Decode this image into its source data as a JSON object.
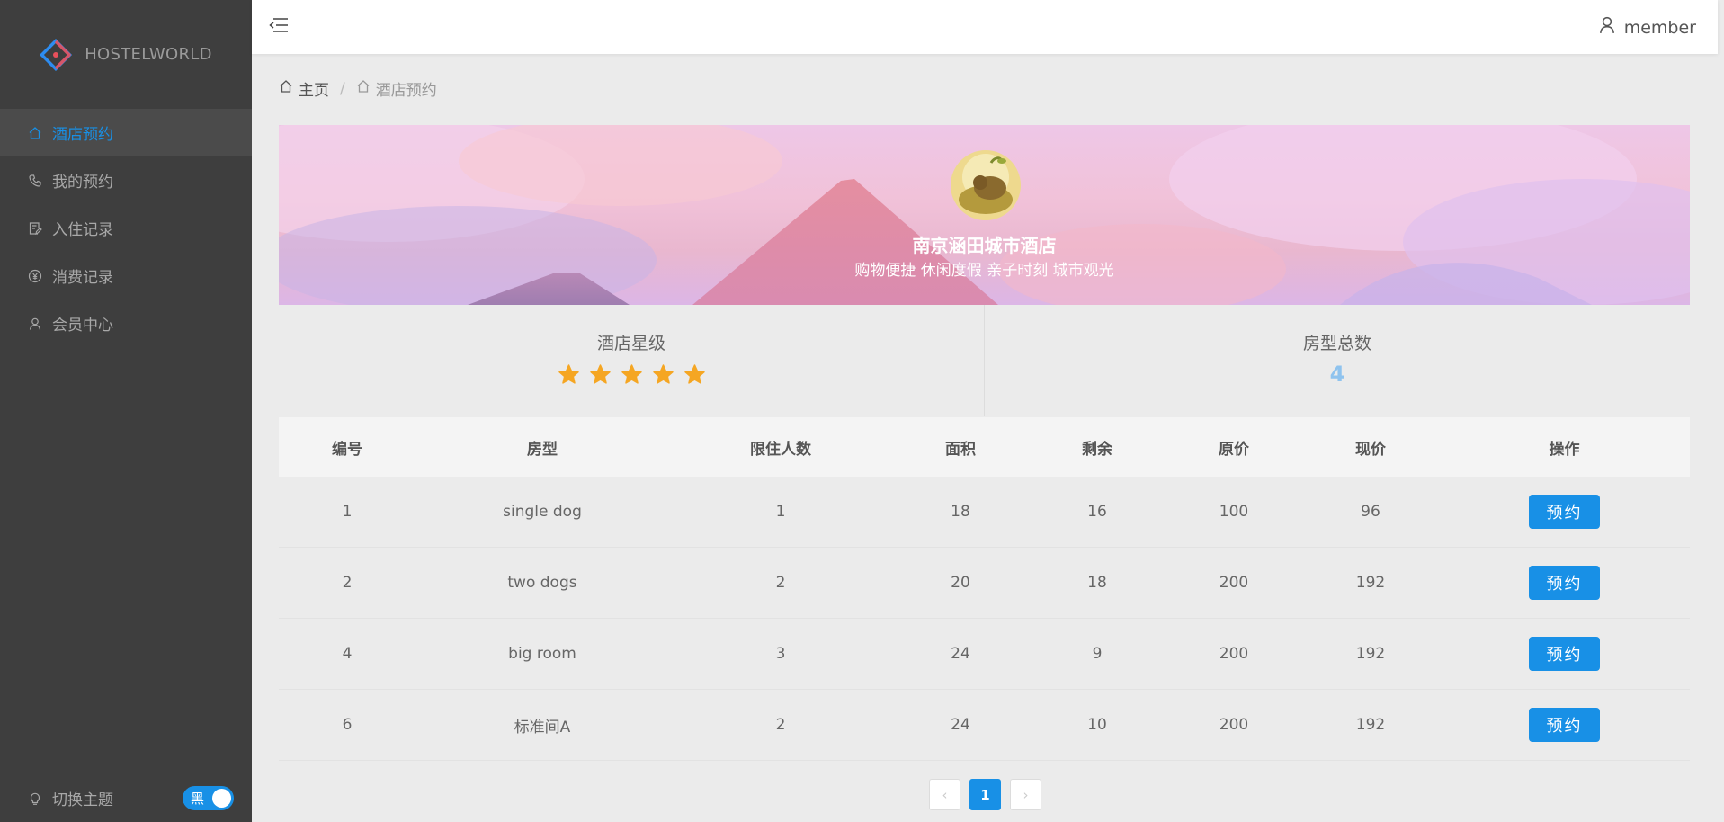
{
  "brand": {
    "name": "HOSTELWORLD"
  },
  "sidebar": {
    "items": [
      {
        "label": "酒店预约",
        "icon": "home-icon",
        "active": true
      },
      {
        "label": "我的预约",
        "icon": "phone-icon",
        "active": false
      },
      {
        "label": "入住记录",
        "icon": "edit-doc-icon",
        "active": false
      },
      {
        "label": "消费记录",
        "icon": "yen-icon",
        "active": false
      },
      {
        "label": "会员中心",
        "icon": "user-icon",
        "active": false
      }
    ],
    "theme": {
      "label": "切换主题",
      "toggle_label": "黑"
    }
  },
  "topbar": {
    "username": "member"
  },
  "breadcrumb": {
    "home": "主页",
    "current": "酒店预约"
  },
  "hotel": {
    "name": "南京涵田城市酒店",
    "slogan": "购物便捷 休闲度假 亲子时刻 城市观光",
    "star_label": "酒店星级",
    "stars": 5,
    "room_type_label": "房型总数",
    "room_type_count": "4"
  },
  "table": {
    "headers": [
      "编号",
      "房型",
      "限住人数",
      "面积",
      "剩余",
      "原价",
      "现价",
      "操作"
    ],
    "rows": [
      {
        "id": "1",
        "type": "single dog",
        "capacity": "1",
        "area": "18",
        "remaining": "16",
        "original": "100",
        "current": "96",
        "action": "预约"
      },
      {
        "id": "2",
        "type": "two dogs",
        "capacity": "2",
        "area": "20",
        "remaining": "18",
        "original": "200",
        "current": "192",
        "action": "预约"
      },
      {
        "id": "4",
        "type": "big room",
        "capacity": "3",
        "area": "24",
        "remaining": "9",
        "original": "200",
        "current": "192",
        "action": "预约"
      },
      {
        "id": "6",
        "type": "标准间A",
        "capacity": "2",
        "area": "24",
        "remaining": "10",
        "original": "200",
        "current": "192",
        "action": "预约"
      }
    ]
  },
  "pagination": {
    "current_page": "1"
  },
  "colors": {
    "accent": "#1890e6",
    "sidebar_bg": "#3e3e3e",
    "star": "#f5a623"
  }
}
